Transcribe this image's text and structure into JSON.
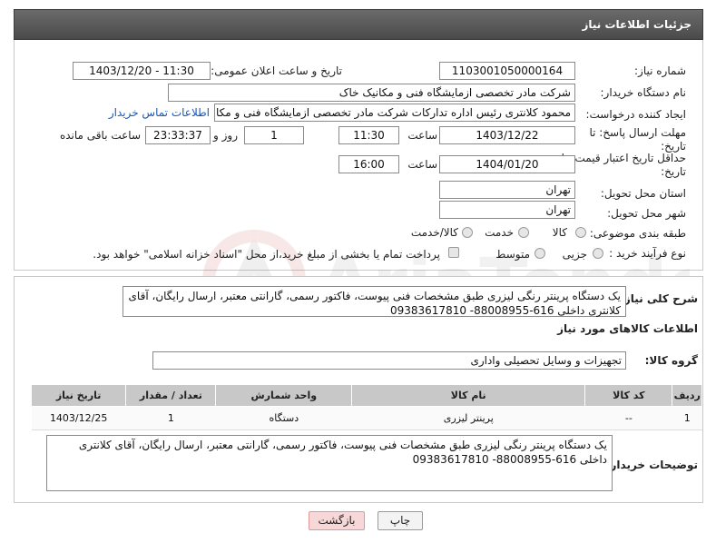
{
  "header": {
    "title": "جزئیات اطلاعات نیاز"
  },
  "form": {
    "need_number_label": "شماره نیاز:",
    "need_number": "1103001050000164",
    "announce_label": "تاریخ و ساعت اعلان عمومی:",
    "announce_value": "1403/12/20 - 11:30",
    "buyer_org_label": "نام دستگاه خریدار:",
    "buyer_org": "شرکت مادر تخصصی ازمایشگاه فنی و مکانیک خاک",
    "requester_label": "ایجاد کننده درخواست:",
    "requester": "محمود کلانتری رئیس اداره تداركات شركت مادر تخصصی ازمايشگاه فنی و مكانيك",
    "buyer_contact_link": "اطلاعات تماس خریدار",
    "reply_deadline_label": "مهلت ارسال پاسخ: تا تاریخ:",
    "reply_date": "1403/12/22",
    "time_label": "ساعت",
    "reply_time": "11:30",
    "days_value": "1",
    "days_label": "روز و",
    "remaining_time": "23:33:37",
    "remaining_label": "ساعت باقی مانده",
    "price_validity_label": "حداقل تاریخ اعتبار قیمت: تا تاریخ:",
    "price_date": "1404/01/20",
    "price_time_label": "ساعت",
    "price_time": "16:00",
    "province_label": "استان محل تحویل:",
    "province": "تهران",
    "city_label": "شهر محل تحویل:",
    "city": "تهران",
    "category_label": "طبقه بندی موضوعی:",
    "category_options": [
      "کالا",
      "خدمت",
      "کالا/خدمت"
    ],
    "purchase_type_label": "نوع فرآیند خرید :",
    "purchase_options": [
      "جزیی",
      "متوسط"
    ],
    "payment_note": "پرداخت تمام یا بخشی از مبلغ خرید،از محل \"اسناد خزانه اسلامی\" خواهد بود."
  },
  "details": {
    "general_desc_label": "شرح کلی نیاز:",
    "general_desc": "یک دستگاه پرینتر رنگی لیزری طبق مشخصات فنی پیوست، فاکتور رسمی، گارانتی معتبر، ارسال رایگان، آقای کلانتری داخلی 616-88008955- 09383617810",
    "goods_info_title": "اطلاعات کالاهای مورد نیاز",
    "goods_group_label": "گروه کالا:",
    "goods_group": "تجهیزات و وسایل تحصیلی واداری",
    "table_headers": [
      "ردیف",
      "کد کالا",
      "نام کالا",
      "واحد شمارش",
      "تعداد / مقدار",
      "تاریخ نیاز"
    ],
    "table_rows": [
      [
        "1",
        "--",
        "پرینتر لیزری",
        "دستگاه",
        "1",
        "1403/12/25"
      ]
    ],
    "buyer_notes_label": "توضیحات خریدار:",
    "buyer_notes": "یک دستگاه پرینتر رنگی لیزری طبق مشخصات فنی پیوست، فاکتور رسمی، گارانتی معتبر، ارسال رایگان، آقای کلانتری داخلی 616-88008955- 09383617810"
  },
  "buttons": {
    "print": "چاپ",
    "back": "بازگشت"
  },
  "watermark_text": "AriaTender.neT",
  "colors": {
    "header_bg": "#555555",
    "link": "#1a56b8",
    "back_btn_bg": "#f7d7d7"
  }
}
